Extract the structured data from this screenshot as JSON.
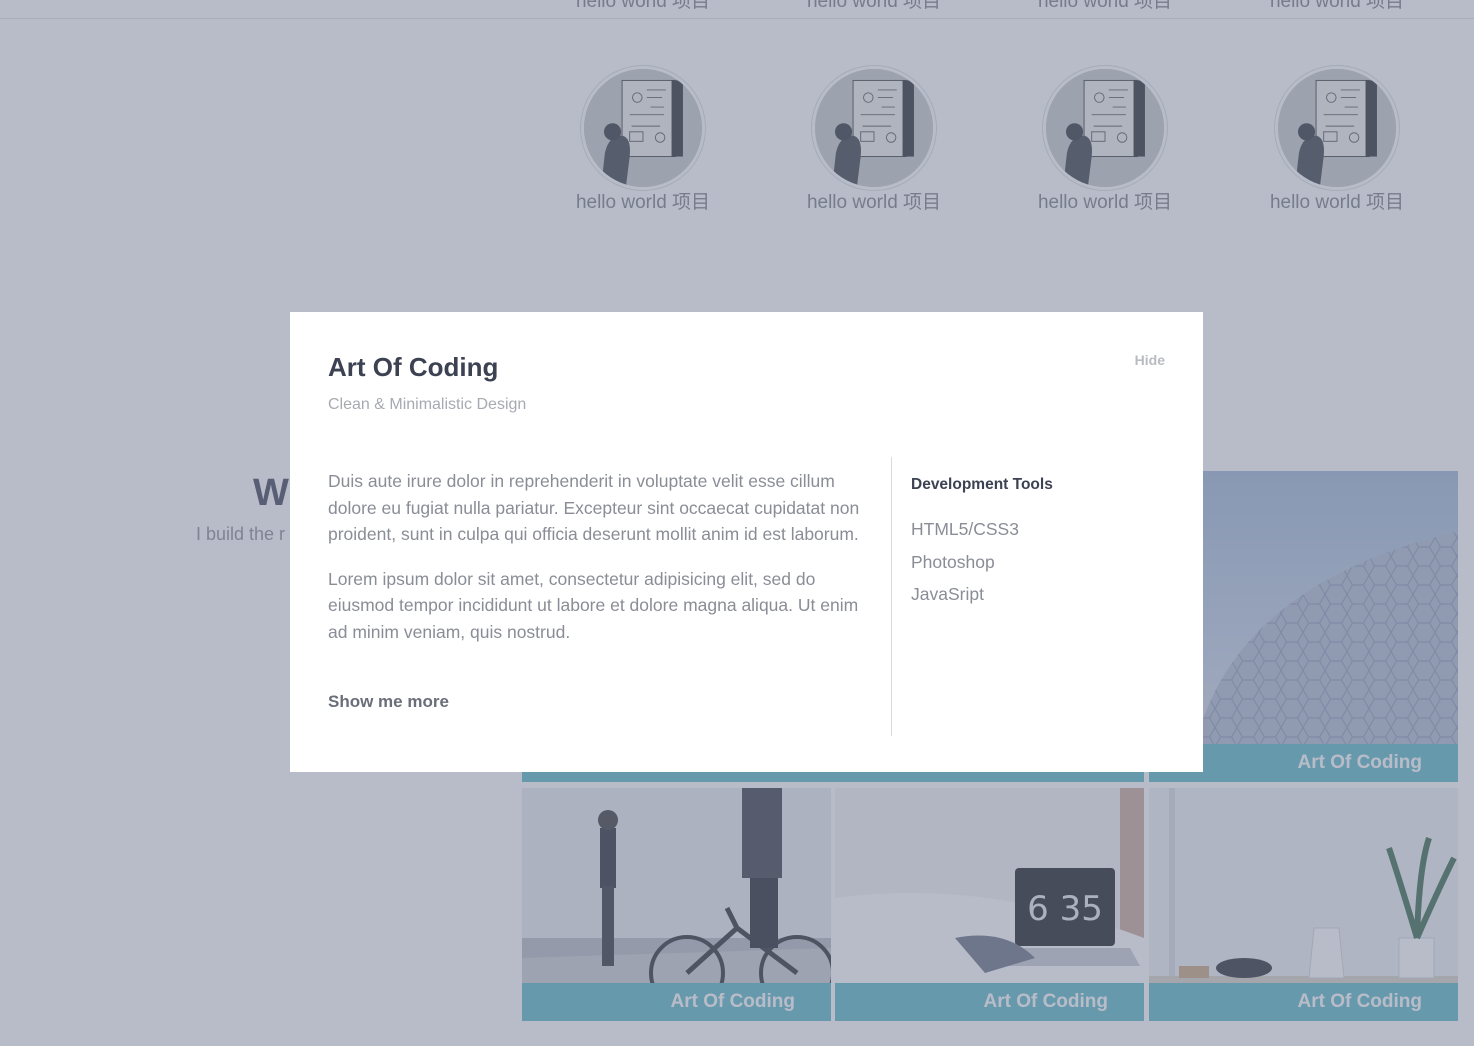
{
  "team": {
    "caption": "hello world 项目",
    "count": 4
  },
  "work": {
    "title": "W",
    "subtitle": "I build the r"
  },
  "portfolio": {
    "tile_label": "Art Of Coding"
  },
  "modal": {
    "title": "Art Of Coding",
    "subtitle": "Clean & Minimalistic Design",
    "hide_label": "Hide",
    "paragraphs": [
      "Duis aute irure dolor in reprehenderit in voluptate velit esse cillum dolore eu fugiat nulla pariatur. Excepteur sint occaecat cupidatat non proident, sunt in culpa qui officia deserunt mollit anim id est laborum.",
      "Lorem ipsum dolor sit amet, consectetur adipisicing elit, sed do eiusmod tempor incididunt ut labore et dolore magna aliqua. Ut enim ad minim veniam, quis nostrud."
    ],
    "more_label": "Show me more",
    "tools_heading": "Development Tools",
    "tools": [
      "HTML5/CSS3",
      "Photoshop",
      "JavaSript"
    ]
  },
  "colors": {
    "overlay": "#717992",
    "tile_label_bg": "#5bb8c7",
    "heading": "#3d4253",
    "body_text": "#8a8d96"
  },
  "icons": [
    "robot-avatar-image"
  ]
}
